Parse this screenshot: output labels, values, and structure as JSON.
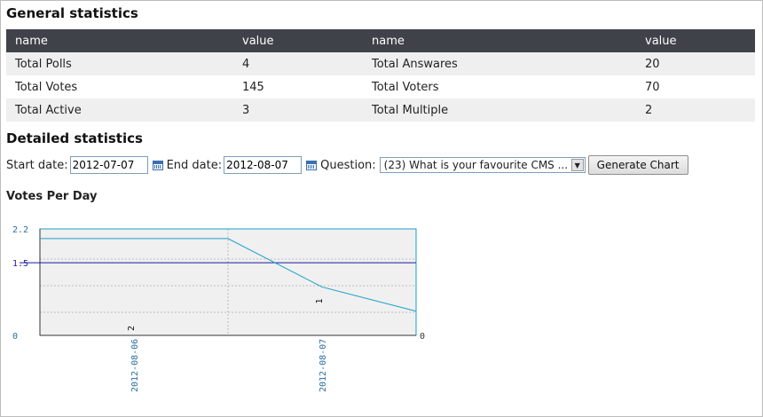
{
  "general": {
    "title": "General statistics",
    "headers": [
      "name",
      "value",
      "name",
      "value"
    ],
    "rows": [
      [
        "Total Polls",
        "4",
        "Total Answares",
        "20"
      ],
      [
        "Total Votes",
        "145",
        "Total Voters",
        "70"
      ],
      [
        "Total Active",
        "3",
        "Total Multiple",
        "2"
      ]
    ]
  },
  "detailed": {
    "title": "Detailed statistics",
    "start_label": "Start date:",
    "start_value": "2012-07-07",
    "end_label": "End date:",
    "end_value": "2012-08-07",
    "question_label": "Question:",
    "question_value": "(23) What is your favourite CMS ...",
    "generate_label": "Generate Chart",
    "icons": [
      "calendar-icon",
      "dropdown-arrow-icon"
    ]
  },
  "chart_data": {
    "type": "line",
    "title": "Votes Per Day",
    "categories": [
      "2012-08-06",
      "2012-08-07"
    ],
    "series": [
      {
        "values": [
          2,
          1
        ],
        "color": "#1aa0c8"
      }
    ],
    "point_labels": [
      "2",
      "1"
    ],
    "average": 1.5,
    "ylim": [
      0,
      2.2
    ],
    "y_ticks": [
      "0",
      "1.5",
      "2.2"
    ],
    "right_tick": "0",
    "grid": true,
    "colors": {
      "line": "#1aa0c8",
      "average": "#1a1aa8",
      "plot_bg": "#f0f0f0",
      "axis_text": "#2a6fa0"
    }
  }
}
